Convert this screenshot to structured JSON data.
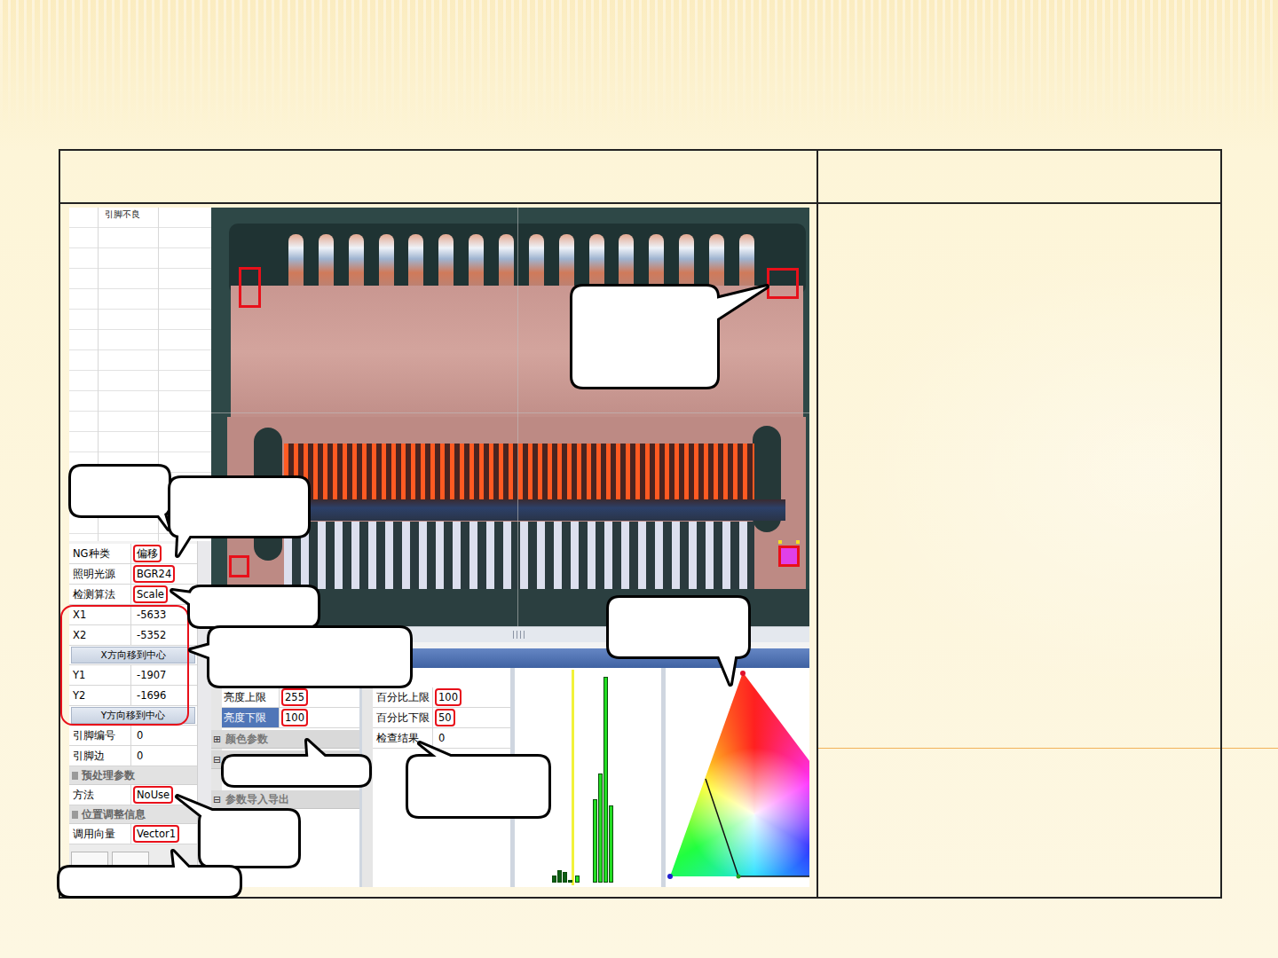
{
  "grid": {
    "header": "引脚不良"
  },
  "param_panel": {
    "rows": [
      {
        "kind": "field",
        "label": "NG种类",
        "value": "偏移",
        "annotated": true
      },
      {
        "kind": "field",
        "label": "照明光源",
        "value": "BGR24",
        "annotated": true
      },
      {
        "kind": "field",
        "label": "检测算法",
        "value": "Scale",
        "annotated": true
      },
      {
        "kind": "field",
        "label": "X1",
        "value": "-5633",
        "annotated": false
      },
      {
        "kind": "field",
        "label": "X2",
        "value": "-5352",
        "annotated": false
      },
      {
        "kind": "button",
        "label": "X方向移到中心"
      },
      {
        "kind": "field",
        "label": "Y1",
        "value": "-1907",
        "annotated": false
      },
      {
        "kind": "field",
        "label": "Y2",
        "value": "-1696",
        "annotated": false
      },
      {
        "kind": "button",
        "label": "Y方向移到中心"
      },
      {
        "kind": "field",
        "label": "引脚编号",
        "value": "0",
        "annotated": false
      },
      {
        "kind": "field",
        "label": "引脚边",
        "value": "0",
        "annotated": false
      },
      {
        "kind": "section",
        "label": "预处理参数"
      },
      {
        "kind": "field",
        "label": "方法",
        "value": "NoUse",
        "annotated": true
      },
      {
        "kind": "section",
        "label": "位置调整信息"
      },
      {
        "kind": "field",
        "label": "调用向量",
        "value": "Vector1",
        "annotated": true
      }
    ]
  },
  "brightness_panel": {
    "rows": [
      {
        "kind": "field",
        "label": "亮度上限",
        "value": "255",
        "annotated": true,
        "selected": false
      },
      {
        "kind": "field",
        "label": "亮度下限",
        "value": "100",
        "annotated": true,
        "selected": true
      },
      {
        "kind": "section",
        "icon": "⊞",
        "label": "颜色参数",
        "expanded": false
      },
      {
        "kind": "section",
        "icon": "⊟",
        "expanded": true
      },
      {
        "kind": "section",
        "icon": "⊟",
        "label": "参数导入导出",
        "expanded": true
      }
    ]
  },
  "percent_panel": {
    "rows": [
      {
        "label": "百分比上限",
        "value": "100",
        "annotated": true
      },
      {
        "label": "百分比下限",
        "value": "50",
        "annotated": true
      },
      {
        "label": "检查结果",
        "value": "0",
        "annotated": false
      }
    ]
  },
  "histogram": {
    "bins": [
      65,
      74,
      84,
      93,
      105,
      137,
      146,
      155,
      164
    ],
    "values": [
      8,
      15,
      12,
      3,
      8,
      97,
      127,
      240,
      90
    ],
    "marker_bin": 101
  }
}
